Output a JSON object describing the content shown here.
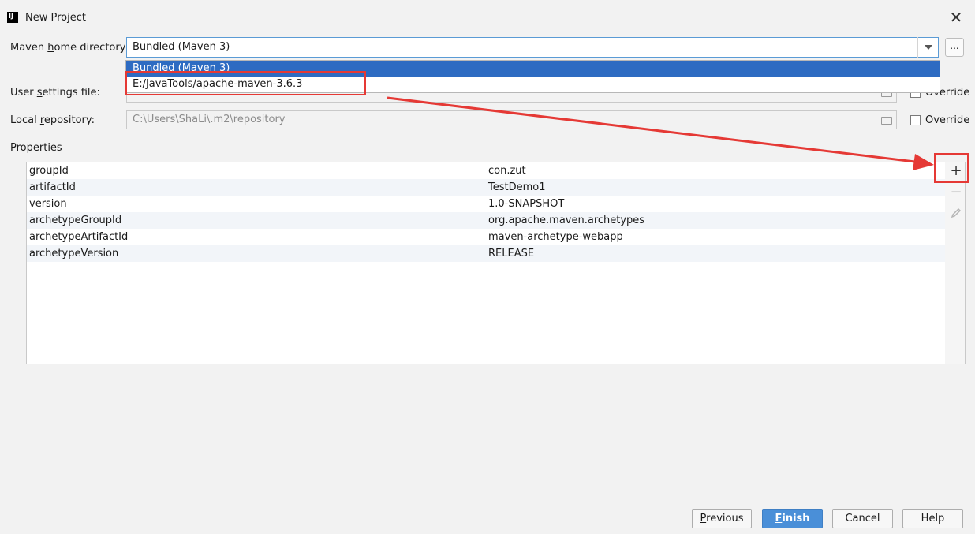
{
  "window": {
    "title": "New Project",
    "app_icon": "IJ",
    "close_glyph": "✕"
  },
  "maven_home": {
    "label_pre": "Maven ",
    "label_u": "h",
    "label_post": "ome directory:",
    "value": "Bundled (Maven 3)",
    "browse_label": "...",
    "dropdown_options": [
      "Bundled (Maven 3)",
      "E:/JavaTools/apache-maven-3.6.3"
    ]
  },
  "user_settings": {
    "label_pre": "User ",
    "label_u": "s",
    "label_post": "ettings file:",
    "override_label": "Override"
  },
  "local_repo": {
    "label_pre": "Local ",
    "label_u": "r",
    "label_post": "epository:",
    "value": "C:\\Users\\ShaLi\\.m2\\repository",
    "override_label": "Override"
  },
  "properties": {
    "section_label": "Properties",
    "rows": [
      {
        "key": "groupId",
        "value": "con.zut"
      },
      {
        "key": "artifactId",
        "value": "TestDemo1"
      },
      {
        "key": "version",
        "value": "1.0-SNAPSHOT"
      },
      {
        "key": "archetypeGroupId",
        "value": "org.apache.maven.archetypes"
      },
      {
        "key": "archetypeArtifactId",
        "value": "maven-archetype-webapp"
      },
      {
        "key": "archetypeVersion",
        "value": "RELEASE"
      }
    ],
    "toolbar": {
      "add": "+",
      "remove": "−"
    }
  },
  "buttons": {
    "previous_u": "P",
    "previous_rest": "revious",
    "finish_u": "F",
    "finish_rest": "inish",
    "cancel": "Cancel",
    "help": "Help"
  },
  "colors": {
    "accent": "#4a8fd8",
    "selection": "#2d6bc2",
    "annotation": "#e53935"
  }
}
